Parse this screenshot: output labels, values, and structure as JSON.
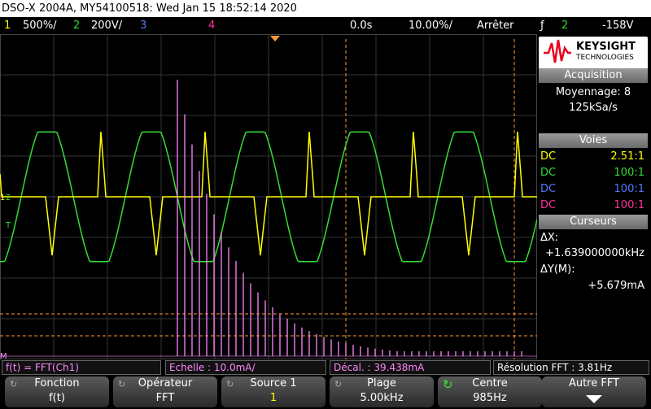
{
  "title": "DSO-X 2004A, MY54100518: Wed Jan 15 18:52:14 2020",
  "status": {
    "ch1_num": "1",
    "ch1_scale": "500%/",
    "ch2_num": "2",
    "ch2_scale": "200V/",
    "ch3_num": "3",
    "ch4_num": "4",
    "time_pos": "0.0s",
    "time_scale": "10.00%/",
    "run_state": "Arrêter",
    "trig_symbol": "ƒ",
    "trig_src": "2",
    "trig_level": "-158V"
  },
  "brand": {
    "name": "KEYSIGHT",
    "sub": "TECHNOLOGIES"
  },
  "acquisition": {
    "title": "Acquisition",
    "mode": "Moyennage: 8",
    "rate": "125kSa/s"
  },
  "channels": {
    "title": "Voies",
    "items": [
      {
        "coupling": "DC",
        "probe": "2.51:1",
        "color": "#ffff00"
      },
      {
        "coupling": "DC",
        "probe": "100:1",
        "color": "#33dd33"
      },
      {
        "coupling": "DC",
        "probe": "100:1",
        "color": "#5577ff"
      },
      {
        "coupling": "DC",
        "probe": "100:1",
        "color": "#ff3399"
      }
    ]
  },
  "cursors": {
    "title": "Curseurs",
    "dx_label": "ΔX:",
    "dx_value": "+1.639000000kHz",
    "dy_label": "ΔY(M):",
    "dy_value": "+5.679mA"
  },
  "fft_bar": {
    "function": "f(t) = FFT(Ch1)",
    "scale": "Echelle : 10.0mA/",
    "offset": "Décal. : 39.438mA",
    "resolution": "Résolution FFT : 3.81Hz"
  },
  "softkeys": [
    {
      "title": "Fonction",
      "value": "f(t)"
    },
    {
      "title": "Opérateur",
      "value": "FFT"
    },
    {
      "title": "Source 1",
      "value": "1"
    },
    {
      "title": "Plage",
      "value": "5.00kHz"
    },
    {
      "title": "Centre",
      "value": "985Hz"
    },
    {
      "title": "Autre FFT",
      "value": ""
    }
  ],
  "markers": {
    "ch1": "1",
    "ch2": "2",
    "trigger": "T",
    "math": "M"
  },
  "colors": {
    "ch1": "#ffff00",
    "ch2": "#33dd33",
    "ch3": "#5577ff",
    "ch4": "#ff3399",
    "math": "#ff88ff",
    "cursor": "#ff9933"
  }
}
